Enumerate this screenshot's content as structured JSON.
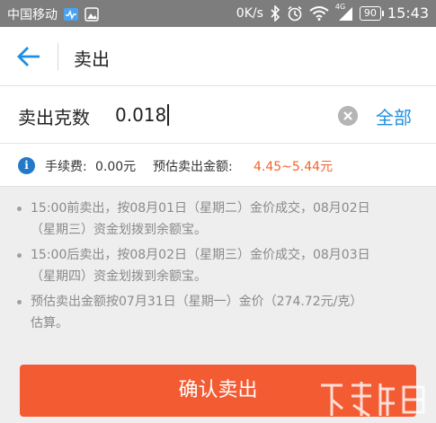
{
  "statusbar": {
    "carrier": "中国移动",
    "net_speed": "0K/s",
    "network_type": "4G",
    "battery": "90",
    "time": "15:43",
    "icons": [
      "heartbeat-icon",
      "image-icon",
      "bluetooth-icon",
      "alarm-icon",
      "wifi-icon",
      "signal-icon",
      "battery-icon"
    ]
  },
  "navbar": {
    "title": "卖出",
    "back_icon": "arrow-left-icon",
    "accent": "#1e8fe1"
  },
  "sell_input": {
    "label": "卖出克数",
    "value": "0.018",
    "all_label": "全部",
    "clear_icon": "clear-circle-icon"
  },
  "fee_info": {
    "fee_label": "手续费:",
    "fee_value": "0.00元",
    "estimate_label": "预估卖出金额:",
    "estimate_value": "4.45~5.44元",
    "estimate_color": "#f2642a"
  },
  "notes": [
    {
      "line1": "15:00前卖出，按08月01日（星期二）金价成交，08月02日",
      "line2": "（星期三）资金划拨到余额宝。"
    },
    {
      "line1": "15:00后卖出，按08月02日（星期三）金价成交，08月03日",
      "line2": "（星期四）资金划拨到余额宝。"
    },
    {
      "line1": "预估卖出金额按07月31日（星期一）金价（274.72元/克）",
      "line2": "估算。"
    }
  ],
  "confirm_button": {
    "label": "确认卖出",
    "color": "#f35b33"
  }
}
